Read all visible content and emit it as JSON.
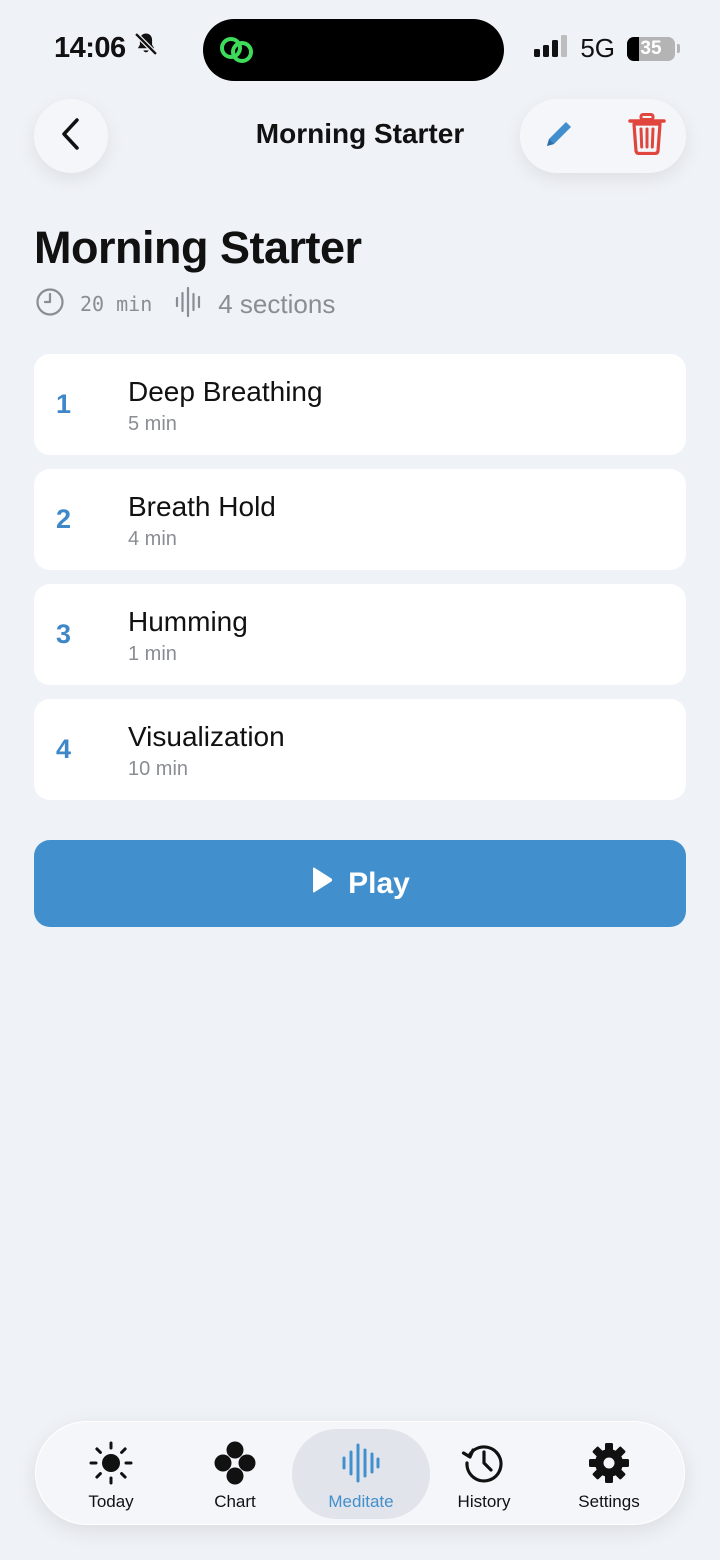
{
  "status_bar": {
    "time": "14:06",
    "network": "5G",
    "battery": "35"
  },
  "header": {
    "title": "Morning Starter"
  },
  "routine": {
    "title": "Morning Starter",
    "duration": "20 min",
    "sections_count": "4 sections"
  },
  "sections": [
    {
      "number": "1",
      "name": "Deep Breathing",
      "duration": "5 min"
    },
    {
      "number": "2",
      "name": "Breath Hold",
      "duration": "4 min"
    },
    {
      "number": "3",
      "name": "Humming",
      "duration": "1 min"
    },
    {
      "number": "4",
      "name": "Visualization",
      "duration": "10 min"
    }
  ],
  "play_button": {
    "label": "Play"
  },
  "tabs": [
    {
      "label": "Today",
      "icon": "sun-icon"
    },
    {
      "label": "Chart",
      "icon": "dots-cluster-icon"
    },
    {
      "label": "Meditate",
      "icon": "waveform-icon",
      "active": true
    },
    {
      "label": "History",
      "icon": "history-clock-icon"
    },
    {
      "label": "Settings",
      "icon": "gear-icon"
    }
  ],
  "colors": {
    "accent": "#428fce",
    "background": "#eff2f7",
    "delete": "#e0463e"
  }
}
